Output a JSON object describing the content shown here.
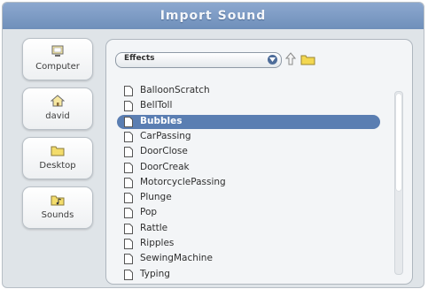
{
  "dialog": {
    "title": "Import Sound"
  },
  "sidebar": {
    "items": [
      {
        "label": "Computer",
        "icon": "computer-icon"
      },
      {
        "label": "david",
        "icon": "home-icon"
      },
      {
        "label": "Desktop",
        "icon": "folder-icon"
      },
      {
        "label": "Sounds",
        "icon": "sounds-folder-icon"
      }
    ]
  },
  "browser": {
    "location": "Effects",
    "up_icon": "up-arrow-icon",
    "new_folder_icon": "new-folder-icon",
    "selected_file": "Bubbles",
    "files": [
      "BalloonScratch",
      "BellToll",
      "Bubbles",
      "CarPassing",
      "DoorClose",
      "DoorCreak",
      "MotorcyclePassing",
      "Plunge",
      "Pop",
      "Rattle",
      "Ripples",
      "SewingMachine",
      "Typing"
    ]
  },
  "colors": {
    "titlebar": "#7b99c3",
    "selection": "#5a7eb2",
    "panel": "#f3f5f7",
    "dialog_bg": "#dfe4e8"
  }
}
